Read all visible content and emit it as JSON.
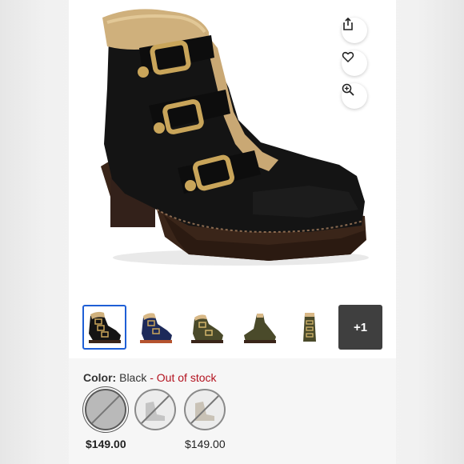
{
  "icons": {
    "share": "share-icon",
    "favorite": "heart-icon",
    "zoom": "zoom-in-icon"
  },
  "thumbnails": {
    "more_label": "+1"
  },
  "color": {
    "label": "Color:",
    "value": "Black",
    "separator": " - ",
    "stock_status": "Out of stock"
  },
  "swatches": [
    {
      "price": "$149.00"
    },
    {
      "price": ""
    },
    {
      "price": "$149.00"
    }
  ],
  "colors": {
    "selected_border": "#1f5fd6",
    "out_of_stock": "#b3121f"
  }
}
